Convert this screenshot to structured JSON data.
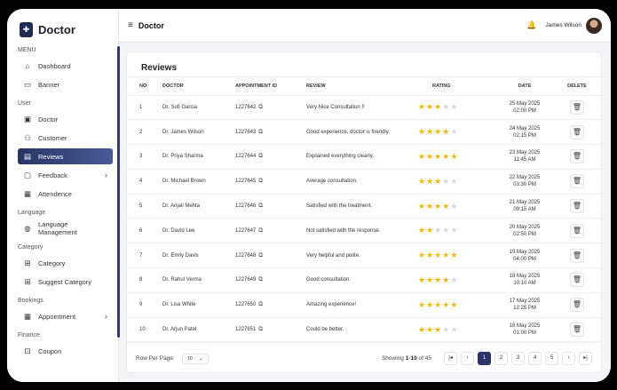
{
  "brand": {
    "name": "Doctor"
  },
  "sidebar": {
    "sections": [
      {
        "label": "MENU",
        "items": [
          {
            "label": "Dashboard",
            "icon": "home-icon"
          },
          {
            "label": "Banner",
            "icon": "monitor-icon"
          }
        ]
      },
      {
        "label": "User",
        "items": [
          {
            "label": "Doctor",
            "icon": "doctor-icon"
          },
          {
            "label": "Customer",
            "icon": "users-icon"
          },
          {
            "label": "Reviews",
            "icon": "reviews-icon",
            "active": true
          },
          {
            "label": "Feedback",
            "icon": "feedback-icon",
            "chevron": true
          },
          {
            "label": "Attendence",
            "icon": "calendar-icon"
          }
        ]
      },
      {
        "label": "Language",
        "items": [
          {
            "label": "Language Management",
            "icon": "globe-icon"
          }
        ]
      },
      {
        "label": "Category",
        "items": [
          {
            "label": "Category",
            "icon": "grid-icon"
          },
          {
            "label": "Suggest Category",
            "icon": "grid-icon"
          }
        ]
      },
      {
        "label": "Bookings",
        "items": [
          {
            "label": "Appointment",
            "icon": "calendar-icon",
            "chevron": true
          }
        ]
      },
      {
        "label": "Finance",
        "items": [
          {
            "label": "Coupon",
            "icon": "coupon-icon"
          }
        ]
      }
    ]
  },
  "topbar": {
    "title": "Doctor",
    "user_name": "James Wilson"
  },
  "reviews": {
    "title": "Reviews",
    "columns": [
      "NO",
      "DOCTOR",
      "APPOINTMENT ID",
      "REVIEW",
      "RATING",
      "DATE",
      "DELETE"
    ],
    "rows": [
      {
        "no": "1",
        "doctor": "Dr. Sofi Garcia",
        "appointment_id": "1227642",
        "review": "Very Nice Consultation !!",
        "rating": 3,
        "date": "25 May 2025",
        "time": "02:00 PM"
      },
      {
        "no": "2",
        "doctor": "Dr. James Wilson",
        "appointment_id": "1227643",
        "review": "Good experience, doctor is friendly.",
        "rating": 4,
        "date": "24 May 2025",
        "time": "02:15 PM"
      },
      {
        "no": "3",
        "doctor": "Dr. Priya Sharma",
        "appointment_id": "1227644",
        "review": "Explained everything clearly.",
        "rating": 5,
        "date": "23 May 2025",
        "time": "11:45 AM"
      },
      {
        "no": "4",
        "doctor": "Dr. Michael Brown",
        "appointment_id": "1227645",
        "review": "Average consultation.",
        "rating": 3,
        "date": "22 May 2025",
        "time": "03:30 PM"
      },
      {
        "no": "5",
        "doctor": "Dr. Anjali Mehta",
        "appointment_id": "1227646",
        "review": "Satisfied with the treatment.",
        "rating": 4,
        "date": "21 May 2025",
        "time": "09:15 AM"
      },
      {
        "no": "6",
        "doctor": "Dr. David Lee",
        "appointment_id": "1227647",
        "review": "Not satisfied with the response.",
        "rating": 2,
        "date": "20 May 2025",
        "time": "02:50 PM"
      },
      {
        "no": "7",
        "doctor": "Dr. Emily Davis",
        "appointment_id": "1227648",
        "review": "Very helpful and polite.",
        "rating": 5,
        "date": "19 May 2025",
        "time": "04:00 PM"
      },
      {
        "no": "8",
        "doctor": "Dr. Rahul Verma",
        "appointment_id": "1227649",
        "review": "Good consultation.",
        "rating": 4,
        "date": "18 May 2025",
        "time": "10:10 AM"
      },
      {
        "no": "9",
        "doctor": "Dr. Lisa White",
        "appointment_id": "1227650",
        "review": "Amazing experience!",
        "rating": 5,
        "date": "17 May 2025",
        "time": "12:25 PM"
      },
      {
        "no": "10",
        "doctor": "Dr. Arjun Patel",
        "appointment_id": "1227651",
        "review": "Could be better.",
        "rating": 3,
        "date": "16 May 2025",
        "time": "01:00 PM"
      }
    ]
  },
  "footer": {
    "rows_per_page_label": "Row Per Page:",
    "rows_per_page_value": "10",
    "showing_prefix": "Showing",
    "showing_range": "1-10",
    "showing_suffix": "of 45",
    "pages": [
      "1",
      "2",
      "3",
      "4",
      "5"
    ],
    "current_page": "1"
  },
  "colors": {
    "accent": "#2a3466",
    "star": "#f2b705"
  }
}
